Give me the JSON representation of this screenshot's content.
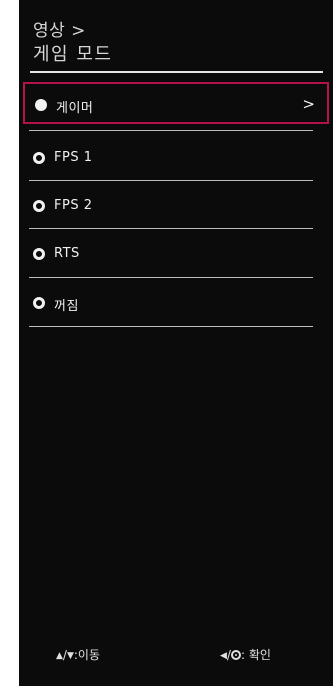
{
  "header": {
    "breadcrumb": "영상 >",
    "title": "게임 모드"
  },
  "menu": {
    "items": [
      {
        "label": "게이머",
        "selected": true,
        "chevron": ">"
      },
      {
        "label": "FPS 1",
        "selected": false
      },
      {
        "label": "FPS 2",
        "selected": false
      },
      {
        "label": "RTS",
        "selected": false
      },
      {
        "label": "꺼짐",
        "selected": false
      }
    ]
  },
  "footer": {
    "nav_up": "▲",
    "nav_sep": "/",
    "nav_down": "▼",
    "nav_label": ":이동",
    "ok_left": "◀",
    "ok_sep": "/",
    "ok_label": ": 확인"
  },
  "colors": {
    "panel_bg": "#0b0b0b",
    "selection_border": "#b3124d",
    "text": "#f0f0f0"
  }
}
